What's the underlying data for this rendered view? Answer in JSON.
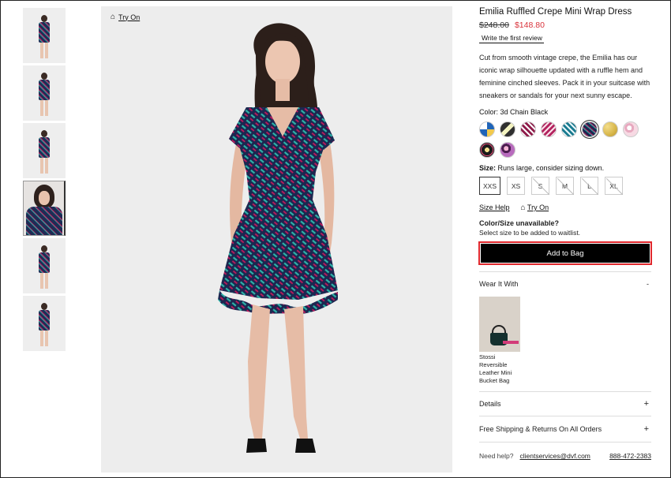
{
  "product": {
    "title": "Emilia Ruffled Crepe Mini Wrap Dress",
    "old_price": "$248.00",
    "new_price": "$148.80",
    "review_link": "Write the first review",
    "description": "Cut from smooth vintage crepe, the Emilia has our iconic wrap silhouette updated with a ruffle hem and feminine cinched sleeves. Pack it in your suitcase with sneakers or sandals for your next sunny escape."
  },
  "gallery": {
    "try_on": "Try On",
    "thumbnail_count": 6,
    "active_thumbnail": 4
  },
  "color": {
    "label": "Color:",
    "value": "3d Chain Black",
    "swatches": [
      "#1f64b8",
      "#2f2f2f",
      "#8e1c4a",
      "#b3245f",
      "#1a7a8f",
      "#2b4a6b",
      "#d7b64a",
      "#e7a9bf",
      "#1b1b1b",
      "#4b1d4f"
    ]
  },
  "size": {
    "label": "Size:",
    "note": "Runs large, consider sizing down.",
    "options": [
      "XXS",
      "XS",
      "S",
      "M",
      "L",
      "XL"
    ],
    "selected": "XXS",
    "help_link": "Size Help",
    "try_on": "Try On"
  },
  "unavailable": {
    "title": "Color/Size unavailable?",
    "subtitle": "Select size to be added to waitlist."
  },
  "cart": {
    "add_label": "Add to Bag"
  },
  "wear_it_with": {
    "heading": "Wear It With",
    "toggle": "-",
    "item_name": "Stossi Reversible Leather Mini Bucket Bag"
  },
  "accordions": {
    "details": "Details",
    "shipping": "Free Shipping & Returns On All Orders",
    "plus": "+"
  },
  "help": {
    "label": "Need help?",
    "email": "clientservices@dvf.com",
    "phone": "888-472-2383"
  },
  "colors": {
    "price_red": "#d9343c",
    "highlight_border": "#e0282d",
    "button_bg": "#000000"
  }
}
